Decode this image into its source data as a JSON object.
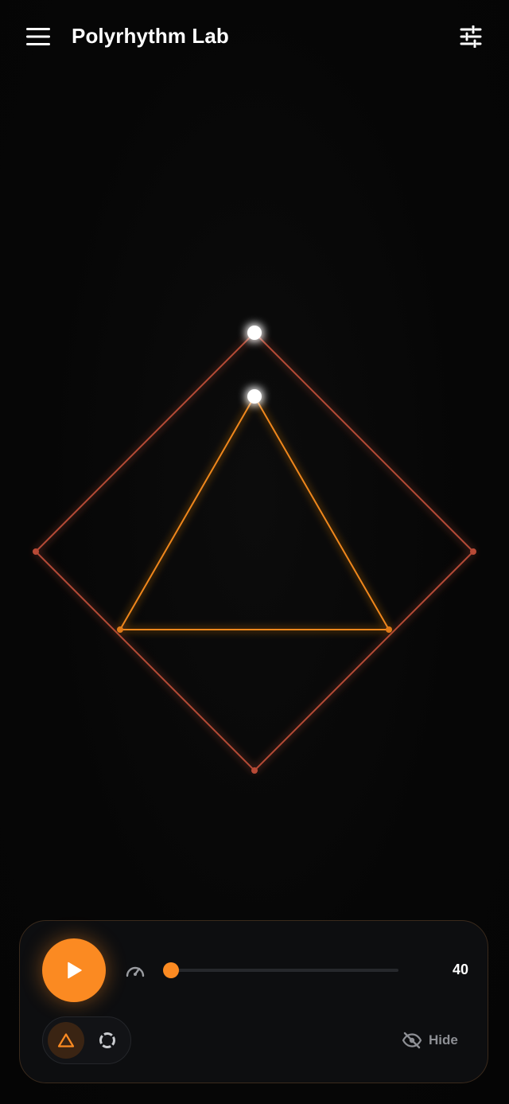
{
  "app": {
    "title": "Polyrhythm Lab"
  },
  "icons": {
    "menu": "menu-icon",
    "settings": "tune-sliders-icon",
    "play": "play-icon",
    "speed": "speedometer-icon",
    "polygon_mode": "triangle-icon",
    "circle_mode": "dashed-circle-icon",
    "hide": "eye-off-icon"
  },
  "colors": {
    "accent": "#fb8a22",
    "triangle_line": "#f0871c",
    "square_line": "#c4513a",
    "background": "#050505",
    "panel": "#0d0e10"
  },
  "shapes": [
    {
      "name": "square",
      "sides": 4
    },
    {
      "name": "triangle",
      "sides": 3
    }
  ],
  "controls": {
    "speed_value": "40",
    "speed_fraction": 0,
    "hide_label": "Hide",
    "mode_selected": "polygon"
  }
}
